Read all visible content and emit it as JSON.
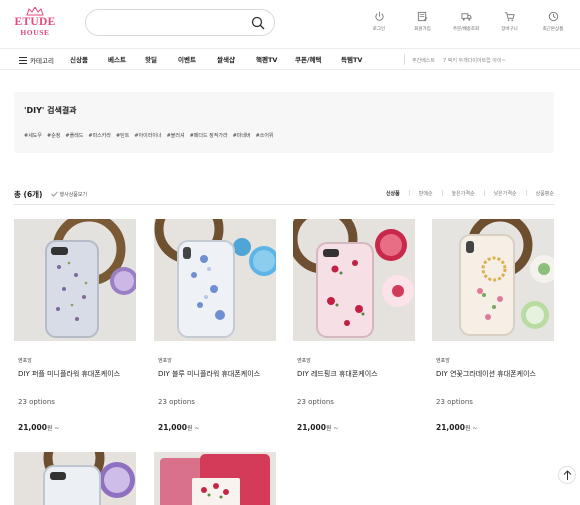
{
  "brand": {
    "line1": "ETUDE",
    "line2": "HOUSE",
    "color": "#e8477a"
  },
  "search": {
    "placeholder": "",
    "value": "",
    "icon": "search-icon"
  },
  "top_links": [
    {
      "label": "로그인",
      "icon": "power-icon"
    },
    {
      "label": "회원가입",
      "icon": "signup-icon"
    },
    {
      "label": "주문/배송조회",
      "icon": "truck-icon"
    },
    {
      "label": "장바구니",
      "icon": "cart-icon"
    },
    {
      "label": "최근본상품",
      "icon": "clock-icon"
    }
  ],
  "nav": {
    "category": "카테고리",
    "items": [
      "신상품",
      "베스트",
      "핫딜",
      "이벤트",
      "쌀색샵",
      "핵펜TV",
      "쿠폰/혜택",
      "득템TV"
    ],
    "weekly_best_label": "주간베스트",
    "weekly_best_item": "7 픽키 두개다이아트립 아이~"
  },
  "result": {
    "title": "'DIY' 검색결과",
    "tags": [
      "#세도우",
      "#순정",
      "#플레드",
      "#마스카라",
      "#틴트",
      "#아이라이너",
      "#블러셔",
      "#페더드 정적가라",
      "#마네버",
      "#쓰어위"
    ]
  },
  "toolbar": {
    "total": "총 (6개)",
    "event_toggle": "행사상품보기",
    "sorts": [
      "신상품",
      "판매순",
      "높은가격순",
      "낮은가격순",
      "상품평순"
    ],
    "active_sort": "신상품"
  },
  "products": [
    {
      "maker": "엔포앙",
      "name": "DIY 퍼플 미니플라워 휴대폰케이스",
      "options": "23 options",
      "price": "21,000",
      "unit": "원 ~"
    },
    {
      "maker": "엔포앙",
      "name": "DIY 블루 미니플라워 휴대폰케이스",
      "options": "23 options",
      "price": "21,000",
      "unit": "원 ~"
    },
    {
      "maker": "엔포앙",
      "name": "DIY 레드핑크 휴대폰케이스",
      "options": "23 options",
      "price": "21,000",
      "unit": "원 ~"
    },
    {
      "maker": "엔포앙",
      "name": "DIY 연꽃그라데이션 휴대폰케이스",
      "options": "23 options",
      "price": "21,000",
      "unit": "원 ~"
    }
  ],
  "scroll_top": {
    "icon": "arrow-up-icon"
  }
}
